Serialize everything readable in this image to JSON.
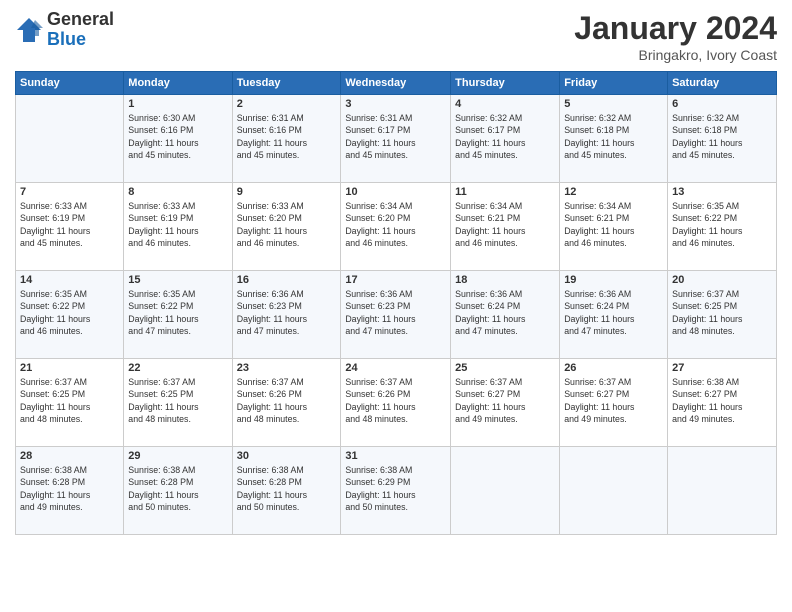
{
  "header": {
    "logo_line1": "General",
    "logo_line2": "Blue",
    "month": "January 2024",
    "location": "Bringakro, Ivory Coast"
  },
  "days_of_week": [
    "Sunday",
    "Monday",
    "Tuesday",
    "Wednesday",
    "Thursday",
    "Friday",
    "Saturday"
  ],
  "weeks": [
    [
      {
        "num": "",
        "info": ""
      },
      {
        "num": "1",
        "info": "Sunrise: 6:30 AM\nSunset: 6:16 PM\nDaylight: 11 hours\nand 45 minutes."
      },
      {
        "num": "2",
        "info": "Sunrise: 6:31 AM\nSunset: 6:16 PM\nDaylight: 11 hours\nand 45 minutes."
      },
      {
        "num": "3",
        "info": "Sunrise: 6:31 AM\nSunset: 6:17 PM\nDaylight: 11 hours\nand 45 minutes."
      },
      {
        "num": "4",
        "info": "Sunrise: 6:32 AM\nSunset: 6:17 PM\nDaylight: 11 hours\nand 45 minutes."
      },
      {
        "num": "5",
        "info": "Sunrise: 6:32 AM\nSunset: 6:18 PM\nDaylight: 11 hours\nand 45 minutes."
      },
      {
        "num": "6",
        "info": "Sunrise: 6:32 AM\nSunset: 6:18 PM\nDaylight: 11 hours\nand 45 minutes."
      }
    ],
    [
      {
        "num": "7",
        "info": "Sunrise: 6:33 AM\nSunset: 6:19 PM\nDaylight: 11 hours\nand 45 minutes."
      },
      {
        "num": "8",
        "info": "Sunrise: 6:33 AM\nSunset: 6:19 PM\nDaylight: 11 hours\nand 46 minutes."
      },
      {
        "num": "9",
        "info": "Sunrise: 6:33 AM\nSunset: 6:20 PM\nDaylight: 11 hours\nand 46 minutes."
      },
      {
        "num": "10",
        "info": "Sunrise: 6:34 AM\nSunset: 6:20 PM\nDaylight: 11 hours\nand 46 minutes."
      },
      {
        "num": "11",
        "info": "Sunrise: 6:34 AM\nSunset: 6:21 PM\nDaylight: 11 hours\nand 46 minutes."
      },
      {
        "num": "12",
        "info": "Sunrise: 6:34 AM\nSunset: 6:21 PM\nDaylight: 11 hours\nand 46 minutes."
      },
      {
        "num": "13",
        "info": "Sunrise: 6:35 AM\nSunset: 6:22 PM\nDaylight: 11 hours\nand 46 minutes."
      }
    ],
    [
      {
        "num": "14",
        "info": "Sunrise: 6:35 AM\nSunset: 6:22 PM\nDaylight: 11 hours\nand 46 minutes."
      },
      {
        "num": "15",
        "info": "Sunrise: 6:35 AM\nSunset: 6:22 PM\nDaylight: 11 hours\nand 47 minutes."
      },
      {
        "num": "16",
        "info": "Sunrise: 6:36 AM\nSunset: 6:23 PM\nDaylight: 11 hours\nand 47 minutes."
      },
      {
        "num": "17",
        "info": "Sunrise: 6:36 AM\nSunset: 6:23 PM\nDaylight: 11 hours\nand 47 minutes."
      },
      {
        "num": "18",
        "info": "Sunrise: 6:36 AM\nSunset: 6:24 PM\nDaylight: 11 hours\nand 47 minutes."
      },
      {
        "num": "19",
        "info": "Sunrise: 6:36 AM\nSunset: 6:24 PM\nDaylight: 11 hours\nand 47 minutes."
      },
      {
        "num": "20",
        "info": "Sunrise: 6:37 AM\nSunset: 6:25 PM\nDaylight: 11 hours\nand 48 minutes."
      }
    ],
    [
      {
        "num": "21",
        "info": "Sunrise: 6:37 AM\nSunset: 6:25 PM\nDaylight: 11 hours\nand 48 minutes."
      },
      {
        "num": "22",
        "info": "Sunrise: 6:37 AM\nSunset: 6:25 PM\nDaylight: 11 hours\nand 48 minutes."
      },
      {
        "num": "23",
        "info": "Sunrise: 6:37 AM\nSunset: 6:26 PM\nDaylight: 11 hours\nand 48 minutes."
      },
      {
        "num": "24",
        "info": "Sunrise: 6:37 AM\nSunset: 6:26 PM\nDaylight: 11 hours\nand 48 minutes."
      },
      {
        "num": "25",
        "info": "Sunrise: 6:37 AM\nSunset: 6:27 PM\nDaylight: 11 hours\nand 49 minutes."
      },
      {
        "num": "26",
        "info": "Sunrise: 6:37 AM\nSunset: 6:27 PM\nDaylight: 11 hours\nand 49 minutes."
      },
      {
        "num": "27",
        "info": "Sunrise: 6:38 AM\nSunset: 6:27 PM\nDaylight: 11 hours\nand 49 minutes."
      }
    ],
    [
      {
        "num": "28",
        "info": "Sunrise: 6:38 AM\nSunset: 6:28 PM\nDaylight: 11 hours\nand 49 minutes."
      },
      {
        "num": "29",
        "info": "Sunrise: 6:38 AM\nSunset: 6:28 PM\nDaylight: 11 hours\nand 50 minutes."
      },
      {
        "num": "30",
        "info": "Sunrise: 6:38 AM\nSunset: 6:28 PM\nDaylight: 11 hours\nand 50 minutes."
      },
      {
        "num": "31",
        "info": "Sunrise: 6:38 AM\nSunset: 6:29 PM\nDaylight: 11 hours\nand 50 minutes."
      },
      {
        "num": "",
        "info": ""
      },
      {
        "num": "",
        "info": ""
      },
      {
        "num": "",
        "info": ""
      }
    ]
  ]
}
